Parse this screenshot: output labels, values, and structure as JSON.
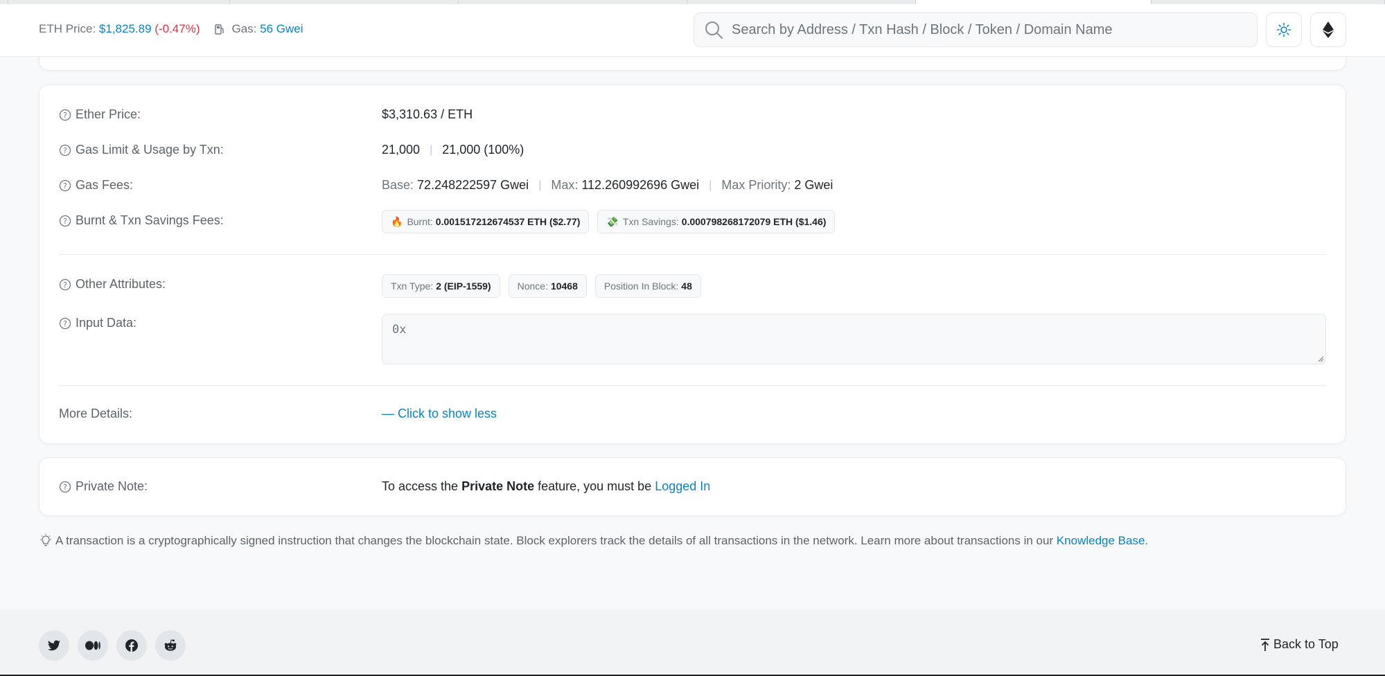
{
  "header": {
    "eth_price_label": "ETH Price:",
    "eth_price_value": "$1,825.89",
    "eth_price_change": "(-0.47%)",
    "gas_label": "Gas:",
    "gas_value": "56 Gwei",
    "search_placeholder": "Search by Address / Txn Hash / Block / Token / Domain Name"
  },
  "details": {
    "ether_price": {
      "label": "Ether Price:",
      "value": "$3,310.63 / ETH"
    },
    "gas_limit": {
      "label": "Gas Limit & Usage by Txn:",
      "limit": "21,000",
      "usage": "21,000 (100%)"
    },
    "gas_fees": {
      "label": "Gas Fees:",
      "base_label": "Base:",
      "base_value": "72.248222597 Gwei",
      "max_label": "Max:",
      "max_value": "112.260992696 Gwei",
      "priority_label": "Max Priority:",
      "priority_value": "2 Gwei"
    },
    "burnt_savings": {
      "label": "Burnt & Txn Savings Fees:",
      "burnt_label": "Burnt:",
      "burnt_value": "0.001517212674537 ETH ($2.77)",
      "savings_label": "Txn Savings:",
      "savings_value": "0.000798268172079 ETH ($1.46)"
    },
    "other_attributes": {
      "label": "Other Attributes:",
      "txn_type_label": "Txn Type:",
      "txn_type_value": "2 (EIP-1559)",
      "nonce_label": "Nonce:",
      "nonce_value": "10468",
      "position_label": "Position In Block:",
      "position_value": "48"
    },
    "input_data": {
      "label": "Input Data:",
      "value": "0x"
    },
    "more_details": {
      "label": "More Details:",
      "link": "— Click to show less"
    }
  },
  "private_note": {
    "label": "Private Note:",
    "text_before": "To access the ",
    "bold": "Private Note",
    "text_after": " feature, you must be ",
    "link": "Logged In"
  },
  "info": {
    "text": "A transaction is a cryptographically signed instruction that changes the blockchain state. Block explorers track the details of all transactions in the network. Learn more about transactions in our ",
    "link": "Knowledge Base",
    "end": "."
  },
  "footer": {
    "back_to_top": "Back to Top",
    "social_icons": [
      "twitter-icon",
      "medium-icon",
      "facebook-icon",
      "reddit-icon"
    ]
  },
  "colors": {
    "accent": "#0784c3",
    "negative": "#dc3545"
  }
}
